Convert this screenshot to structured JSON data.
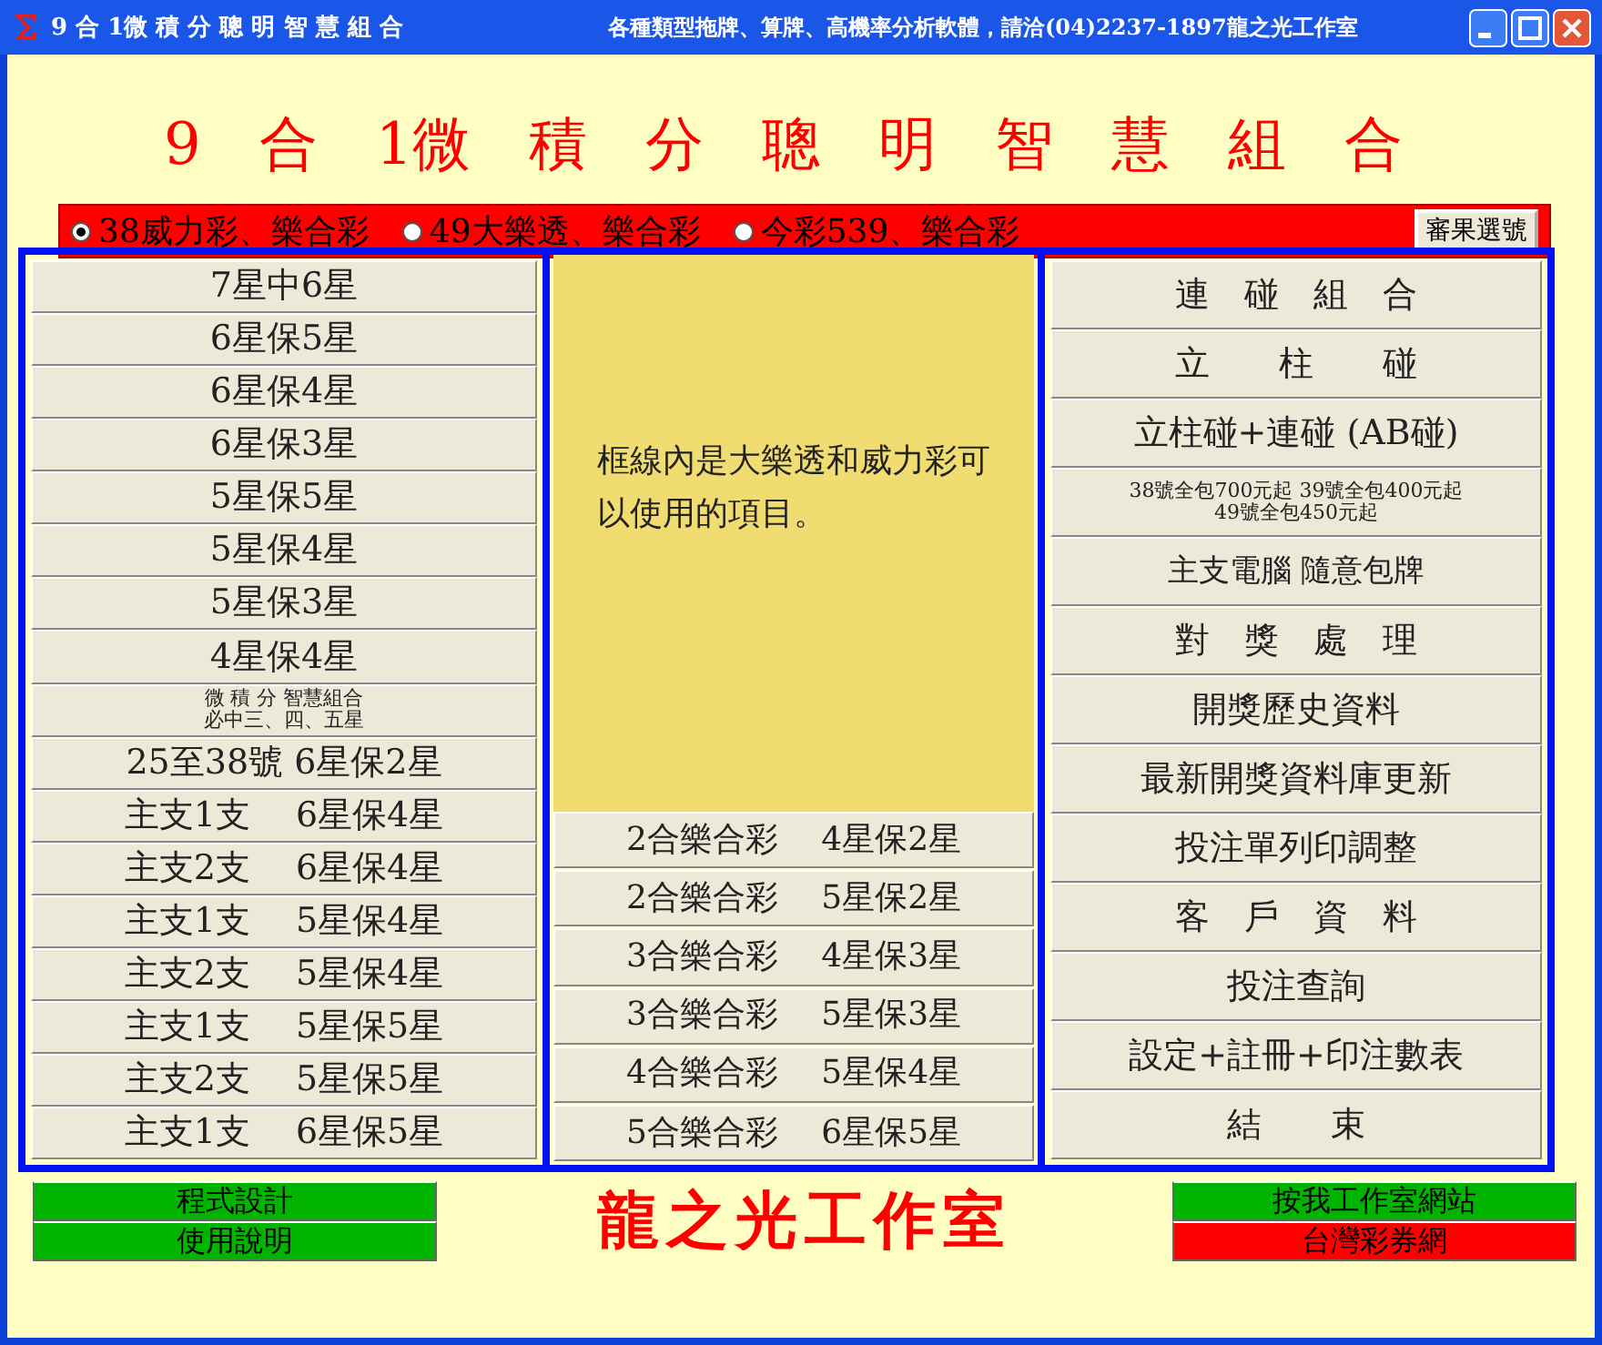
{
  "window": {
    "title": "9 合 1微 積 分 聰 明 智 慧 組 合",
    "tagline": "各種類型拖牌、算牌、高機率分析軟體，請洽(04)2237-1897龍之光工作室"
  },
  "heading": "9　合　1微　積　分　聰　明　智　慧　組　合",
  "game_options": [
    {
      "label": "38威力彩、樂合彩",
      "selected": true
    },
    {
      "label": "49大樂透、樂合彩",
      "selected": false
    },
    {
      "label": "今彩539、樂合彩",
      "selected": false
    }
  ],
  "pick_button": "審果選號",
  "left_buttons": [
    {
      "lines": [
        "7星中6星"
      ],
      "kind": "large"
    },
    {
      "lines": [
        "6星保5星"
      ],
      "kind": "large"
    },
    {
      "lines": [
        "6星保4星"
      ],
      "kind": "large"
    },
    {
      "lines": [
        "6星保3星"
      ],
      "kind": "large"
    },
    {
      "lines": [
        "5星保5星"
      ],
      "kind": "large"
    },
    {
      "lines": [
        "5星保4星"
      ],
      "kind": "large"
    },
    {
      "lines": [
        "5星保3星"
      ],
      "kind": "large"
    },
    {
      "lines": [
        "4星保4星"
      ],
      "kind": "large"
    },
    {
      "lines": [
        "微 積 分 智慧組合",
        "必中三、四、五星"
      ],
      "kind": "small"
    },
    {
      "lines": [
        "25至38號 6星保2星"
      ],
      "kind": "large"
    },
    {
      "lines": [
        "主支1支　 6星保4星"
      ],
      "kind": "large"
    },
    {
      "lines": [
        "主支2支　 6星保4星"
      ],
      "kind": "large"
    },
    {
      "lines": [
        "主支1支　 5星保4星"
      ],
      "kind": "large"
    },
    {
      "lines": [
        "主支2支　 5星保4星"
      ],
      "kind": "large"
    },
    {
      "lines": [
        "主支1支　 5星保5星"
      ],
      "kind": "large"
    },
    {
      "lines": [
        "主支2支　 5星保5星"
      ],
      "kind": "large"
    },
    {
      "lines": [
        "主支1支　 6星保5星"
      ],
      "kind": "large"
    }
  ],
  "note": "框線內是大樂透和威力彩可以使用的項目。",
  "middle_buttons": [
    {
      "lines": [
        "2合樂合彩　 4星保2星"
      ],
      "kind": "large"
    },
    {
      "lines": [
        "2合樂合彩　 5星保2星"
      ],
      "kind": "large"
    },
    {
      "lines": [
        "3合樂合彩　 4星保3星"
      ],
      "kind": "large"
    },
    {
      "lines": [
        "3合樂合彩　 5星保3星"
      ],
      "kind": "large"
    },
    {
      "lines": [
        "4合樂合彩　 5星保4星"
      ],
      "kind": "large"
    },
    {
      "lines": [
        "5合樂合彩　 6星保5星"
      ],
      "kind": "large"
    }
  ],
  "right_buttons": [
    {
      "lines": [
        "連　碰　組　合"
      ],
      "kind": "large"
    },
    {
      "lines": [
        "立　　柱　　碰"
      ],
      "kind": "large"
    },
    {
      "lines": [
        "立柱碰+連碰 (AB碰)"
      ],
      "kind": "large"
    },
    {
      "lines": [
        "38號全包700元起 39號全包400元起",
        "49號全包450元起"
      ],
      "kind": "small"
    },
    {
      "lines": [
        "主支電腦 隨意包牌"
      ],
      "kind": "medium"
    },
    {
      "lines": [
        "對　獎　處　理"
      ],
      "kind": "large"
    },
    {
      "lines": [
        "開獎歷史資料"
      ],
      "kind": "large"
    },
    {
      "lines": [
        "最新開獎資料庫更新"
      ],
      "kind": "large"
    },
    {
      "lines": [
        "投注單列印調整"
      ],
      "kind": "large"
    },
    {
      "lines": [
        "客　戶　資　料"
      ],
      "kind": "large"
    },
    {
      "lines": [
        "投注查詢"
      ],
      "kind": "large"
    },
    {
      "lines": [
        "設定+註冊+印注數表"
      ],
      "kind": "large"
    },
    {
      "lines": [
        "結　　束"
      ],
      "kind": "large"
    }
  ],
  "footer_left": [
    {
      "label": "程式設計",
      "color": "#00b400"
    },
    {
      "label": "使用說明",
      "color": "#00b400"
    }
  ],
  "studio_name": "龍之光工作室",
  "footer_right": [
    {
      "label": "按我工作室網站",
      "color": "#00b400"
    },
    {
      "label": "台灣彩券網",
      "color": "#ff0000"
    }
  ]
}
